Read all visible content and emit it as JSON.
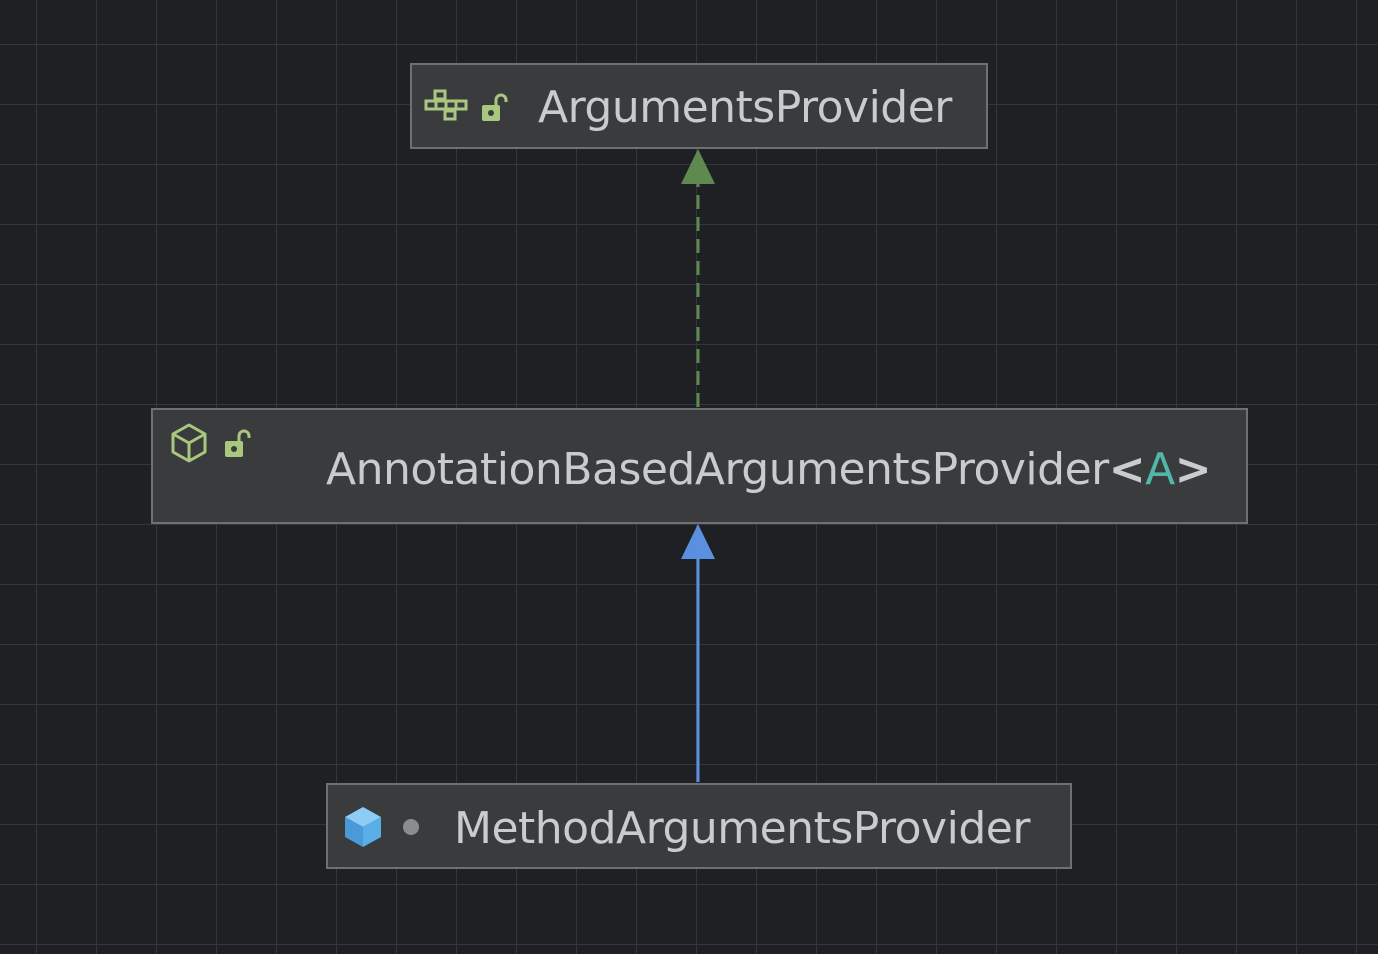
{
  "diagram": {
    "nodes": [
      {
        "id": "arguments-provider",
        "name": "ArgumentsProvider",
        "kind_icon": "interface-icon",
        "visibility_icon": "public-unlock-icon"
      },
      {
        "id": "annotation-based-arguments-provider",
        "name": "AnnotationBasedArgumentsProvider",
        "generic_open": "<",
        "generic_param": "A",
        "generic_close": ">",
        "kind_icon": "abstract-class-icon",
        "visibility_icon": "public-unlock-icon"
      },
      {
        "id": "method-arguments-provider",
        "name": "MethodArgumentsProvider",
        "kind_icon": "class-icon",
        "visibility_icon": "package-private-dot-icon"
      }
    ],
    "edges": [
      {
        "from": "annotation-based-arguments-provider",
        "to": "arguments-provider",
        "relation": "implements",
        "style": "dashed",
        "color": "#5f8a4f"
      },
      {
        "from": "method-arguments-provider",
        "to": "annotation-based-arguments-provider",
        "relation": "extends",
        "style": "solid",
        "color": "#5b8fe0"
      }
    ],
    "colors": {
      "background": "#1f2024",
      "grid": "#34363b",
      "node_fill": "#3a3b3d",
      "node_border": "#6e7074",
      "text": "#c9cbcf",
      "generic_param": "#4fb8a8",
      "icon_green": "#a9c77e",
      "class_blue": "#5aaee8",
      "implements_edge": "#5f8a4f",
      "extends_edge": "#5b8fe0"
    }
  }
}
